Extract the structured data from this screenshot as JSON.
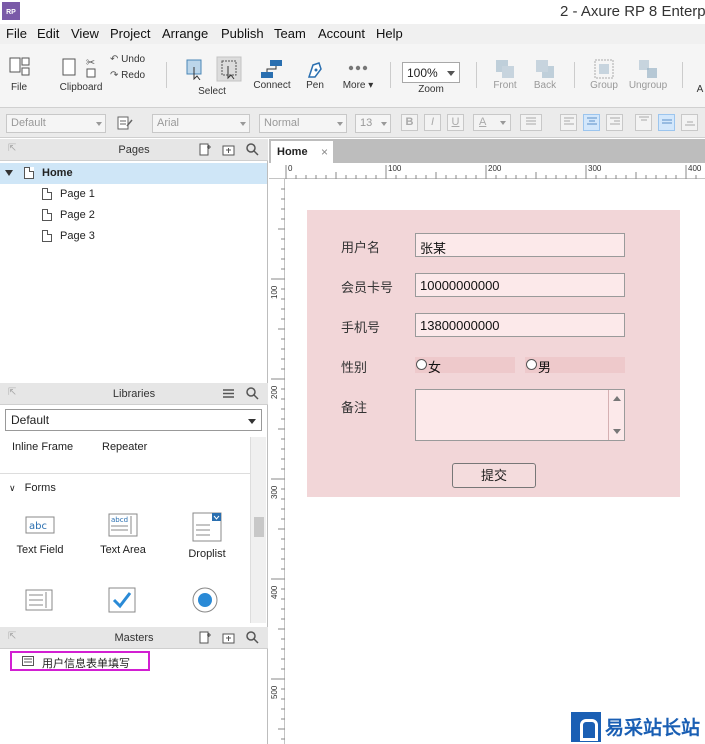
{
  "window": {
    "title": "2 - Axure RP 8 Enterp",
    "app_icon_text": "RP"
  },
  "menu": [
    "File",
    "Edit",
    "View",
    "Project",
    "Arrange",
    "Publish",
    "Team",
    "Account",
    "Help"
  ],
  "toolbar": {
    "file": "File",
    "clipboard": "Clipboard",
    "undo": "Undo",
    "redo": "Redo",
    "select": "Select",
    "connect": "Connect",
    "pen": "Pen",
    "more": "More ▾",
    "zoom_value": "100%",
    "zoom": "Zoom",
    "front": "Front",
    "back": "Back",
    "group": "Group",
    "ungroup": "Ungroup",
    "cut_off": "A"
  },
  "format": {
    "style": "Default",
    "font": "Arial",
    "weight": "Normal",
    "size": "13",
    "bold": "B",
    "italic": "I",
    "underline": "U",
    "font_color": "A"
  },
  "pages_panel": {
    "title": "Pages",
    "items": [
      {
        "label": "Home"
      },
      {
        "label": "Page 1"
      },
      {
        "label": "Page 2"
      },
      {
        "label": "Page 3"
      }
    ]
  },
  "libraries_panel": {
    "title": "Libraries",
    "selected": "Default",
    "top_items": [
      "Inline Frame",
      "Repeater"
    ],
    "section": "Forms",
    "widgets": [
      "Text Field",
      "Text Area",
      "Droplist"
    ],
    "widget_icon_text": {
      "text_field": "abc",
      "text_area": "abcd"
    }
  },
  "masters_panel": {
    "title": "Masters",
    "items": [
      "用户信息表单填写"
    ]
  },
  "tab": {
    "label": "Home",
    "close": "×"
  },
  "rulers": {
    "horizontal": [
      "0",
      "100",
      "200",
      "300",
      "400"
    ],
    "vertical": [
      "100",
      "200",
      "300",
      "400",
      "500"
    ]
  },
  "form": {
    "username_label": "用户名",
    "username_value": "张某",
    "member_label": "会员卡号",
    "member_value": "10000000000",
    "phone_label": "手机号",
    "phone_value": "13800000000",
    "gender_label": "性别",
    "gender_female": "女",
    "gender_male": "男",
    "remark_label": "备注",
    "submit": "提交"
  },
  "watermark": {
    "text": "易采站长站"
  },
  "colors": {
    "form_bg": "#f2d6d8",
    "input_bg": "#fce9ea",
    "master_highlight": "#d21fd2",
    "selected_page": "#cfe6f7"
  }
}
